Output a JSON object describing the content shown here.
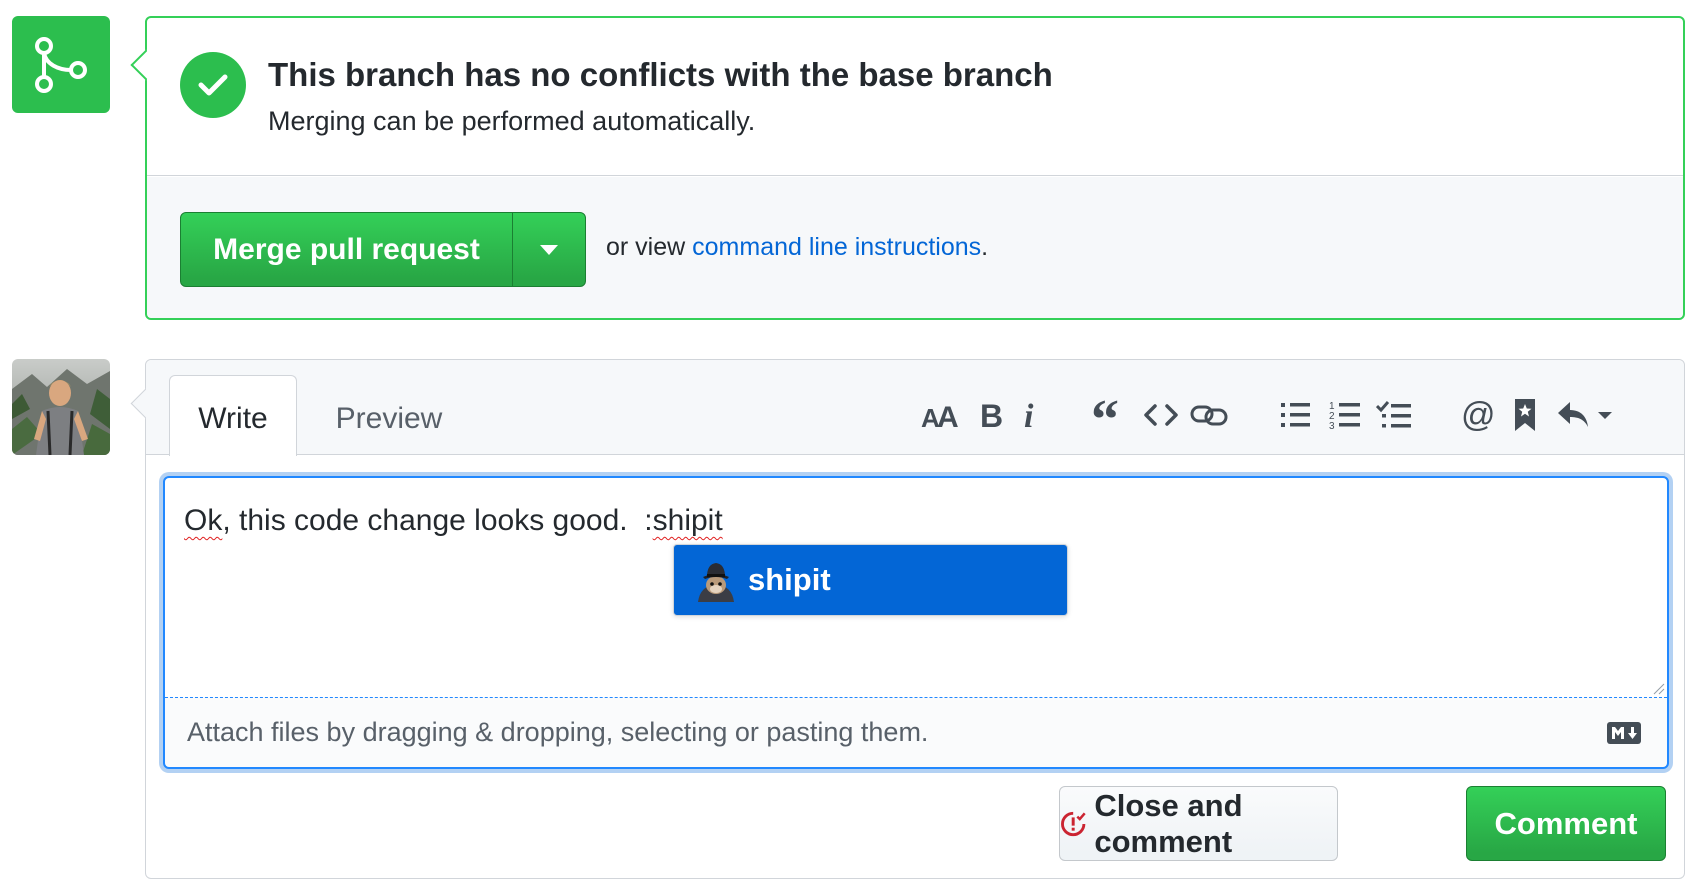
{
  "merge": {
    "title": "This branch has no conflicts with the base branch",
    "subtitle": "Merging can be performed automatically.",
    "merge_button": "Merge pull request",
    "alt_prefix": "or view ",
    "alt_link": "command line instructions",
    "alt_suffix": ".",
    "icon": "git-merge-icon",
    "status_color": "#2cbe4e"
  },
  "comment": {
    "tabs": [
      {
        "label": "Write",
        "active": true
      },
      {
        "label": "Preview",
        "active": false
      }
    ],
    "toolbar": [
      "text-size-icon",
      "bold-icon",
      "italic-icon",
      "quote-icon",
      "code-icon",
      "link-icon",
      "unordered-list-icon",
      "ordered-list-icon",
      "task-list-icon",
      "mention-icon",
      "reference-icon",
      "saved-reply-icon"
    ],
    "text_before": "Ok",
    "text_middle": ", this code change looks good.  :",
    "text_after": "shipit",
    "suggestion": "shipit",
    "attach_hint": "Attach files by dragging & dropping, selecting or pasting them.",
    "close_button": "Close and comment",
    "comment_button": "Comment",
    "accent_color": "#0366d6"
  }
}
